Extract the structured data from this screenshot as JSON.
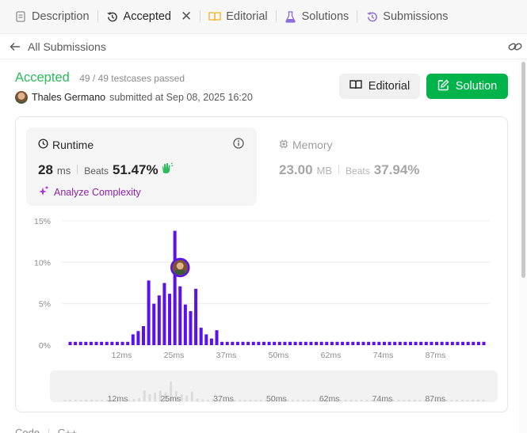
{
  "tabs": [
    {
      "label": "Description",
      "icon": "description-icon",
      "active": false
    },
    {
      "label": "Accepted",
      "icon": "history-icon",
      "active": true
    },
    {
      "label": "Editorial",
      "icon": "book-icon",
      "active": false
    },
    {
      "label": "Solutions",
      "icon": "flask-icon",
      "active": false
    },
    {
      "label": "Submissions",
      "icon": "history-icon",
      "active": false
    }
  ],
  "subheader": {
    "back_label": "All Submissions"
  },
  "submission": {
    "status": "Accepted",
    "testcases": "49 / 49 testcases passed",
    "user": "Thales Germano",
    "submitted": "submitted at Sep 08, 2025 16:20"
  },
  "buttons": {
    "editorial": "Editorial",
    "solution": "Solution"
  },
  "runtime": {
    "label": "Runtime",
    "value": "28",
    "unit": "ms",
    "beats_label": "Beats",
    "beats": "51.47%",
    "analyze": "Analyze Complexity"
  },
  "memory": {
    "label": "Memory",
    "value": "23.00",
    "unit": "MB",
    "beats_label": "Beats",
    "beats": "37.94%"
  },
  "colors": {
    "accent_green": "#2cbb5d",
    "button_green": "#00b34a",
    "bar": "#5b10f0",
    "purple": "#8e24aa"
  },
  "chart_data": {
    "type": "bar",
    "ylim": [
      0,
      15
    ],
    "yticks": [
      "15%",
      "10%",
      "5%",
      "0%"
    ],
    "xticks": [
      "12ms",
      "25ms",
      "37ms",
      "50ms",
      "62ms",
      "74ms",
      "87ms"
    ],
    "highlight_index": 21,
    "values": [
      0.4,
      0.4,
      0.4,
      0.4,
      0.4,
      0.4,
      0.4,
      0.4,
      0.4,
      0.4,
      0.4,
      0.4,
      1.3,
      1.7,
      2.3,
      7.8,
      5.0,
      6.0,
      7.5,
      6.2,
      13.8,
      7.1,
      4.9,
      4.1,
      6.8,
      2.1,
      1.3,
      0.8,
      1.8,
      0.4,
      0.4,
      0.4,
      0.4,
      0.4,
      0.4,
      0.4,
      0.4,
      0.4,
      0.4,
      0.4,
      0.4,
      0.4,
      0.4,
      0.4,
      0.4,
      0.4,
      0.4,
      0.4,
      0.4,
      0.4,
      0.4,
      0.4,
      0.4,
      0.4,
      0.4,
      0.4,
      0.4,
      0.4,
      0.4,
      0.4,
      0.4,
      0.4,
      0.4,
      0.4,
      0.4,
      0.4,
      0.4,
      0.4,
      0.4,
      0.4,
      0.4,
      0.4,
      0.4,
      0.4,
      0.4,
      0.4,
      0.4,
      0.4,
      0.4,
      0.4
    ]
  },
  "bottom": {
    "code_label": "Code",
    "language": "C++"
  }
}
